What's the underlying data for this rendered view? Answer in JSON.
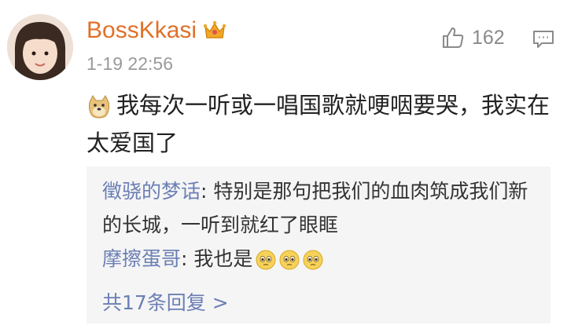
{
  "post": {
    "username": "BossKkasi",
    "badge_icon": "crown-icon",
    "timestamp": "1-19 22:56",
    "like_count": "162",
    "comment_text": "我每次一听或一唱国歌就哽咽要哭，我实在太爱国了",
    "comment_emoji_icon": "doge-emoji-icon"
  },
  "replies": [
    {
      "name": "徵骁的梦话",
      "text": ": 特别是那句把我们的血肉筑成我们新的长城，一听到就红了眼眶"
    },
    {
      "name": "摩擦蛋哥",
      "text": ": 我也是",
      "emoji_icon": "teary-eyes-emoji-icon",
      "emoji_count": 3
    }
  ],
  "more_replies_label": "共17条回复 >",
  "colors": {
    "username": "#e07028",
    "reply_name": "#6b7fb5",
    "reply_bg": "#f5f5f5"
  }
}
